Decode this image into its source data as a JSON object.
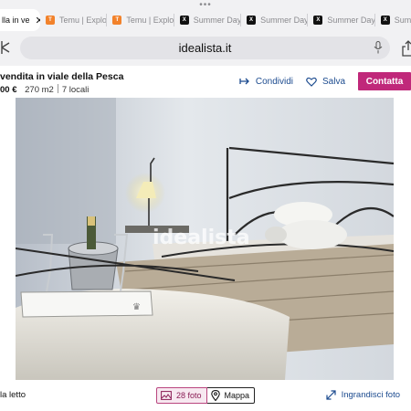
{
  "browser": {
    "tabs": [
      {
        "label": "lla in ve",
        "favicon": "idealista",
        "active": true
      },
      {
        "label": "Temu | Explo",
        "favicon": "temu-icon"
      },
      {
        "label": "Temu | Explo",
        "favicon": "temu-icon"
      },
      {
        "label": "Summer Day",
        "favicon": "x-icon"
      },
      {
        "label": "Summer Day",
        "favicon": "x-icon"
      },
      {
        "label": "Summer Day",
        "favicon": "x-icon"
      },
      {
        "label": "Sum",
        "favicon": "x-icon"
      }
    ],
    "url": "idealista.it"
  },
  "listing": {
    "title": "vendita in viale della Pesca",
    "price": "00 €",
    "area": "270 m2",
    "rooms": "7 locali",
    "share_label": "Condividi",
    "save_label": "Salva",
    "contact_label": "Contatta",
    "watermark": "idealista"
  },
  "gallery": {
    "caption": "la letto",
    "photos_label": "28 foto",
    "map_label": "Mappa",
    "enlarge_label": "Ingrandisci foto"
  },
  "colors": {
    "accent": "#c0287a",
    "link": "#1c4b8f"
  }
}
